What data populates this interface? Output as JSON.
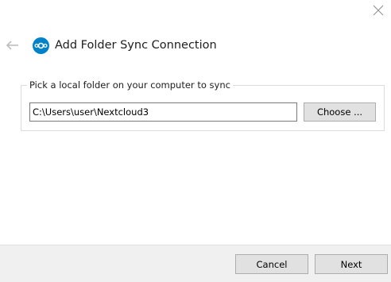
{
  "window": {
    "close_icon": "close-icon",
    "back_icon": "back-arrow-icon"
  },
  "header": {
    "logo_icon": "nextcloud-logo-icon",
    "title": "Add Folder Sync Connection"
  },
  "local_folder": {
    "legend": "Pick a local folder on your computer to sync",
    "path_value": "C:\\Users\\user\\Nextcloud3",
    "choose_label": "Choose ..."
  },
  "footer": {
    "cancel_label": "Cancel",
    "next_label": "Next"
  },
  "colors": {
    "brand": "#0082c9",
    "footer_bg": "#f0f0f0",
    "button_bg": "#e1e1e1",
    "button_border": "#adadad"
  }
}
